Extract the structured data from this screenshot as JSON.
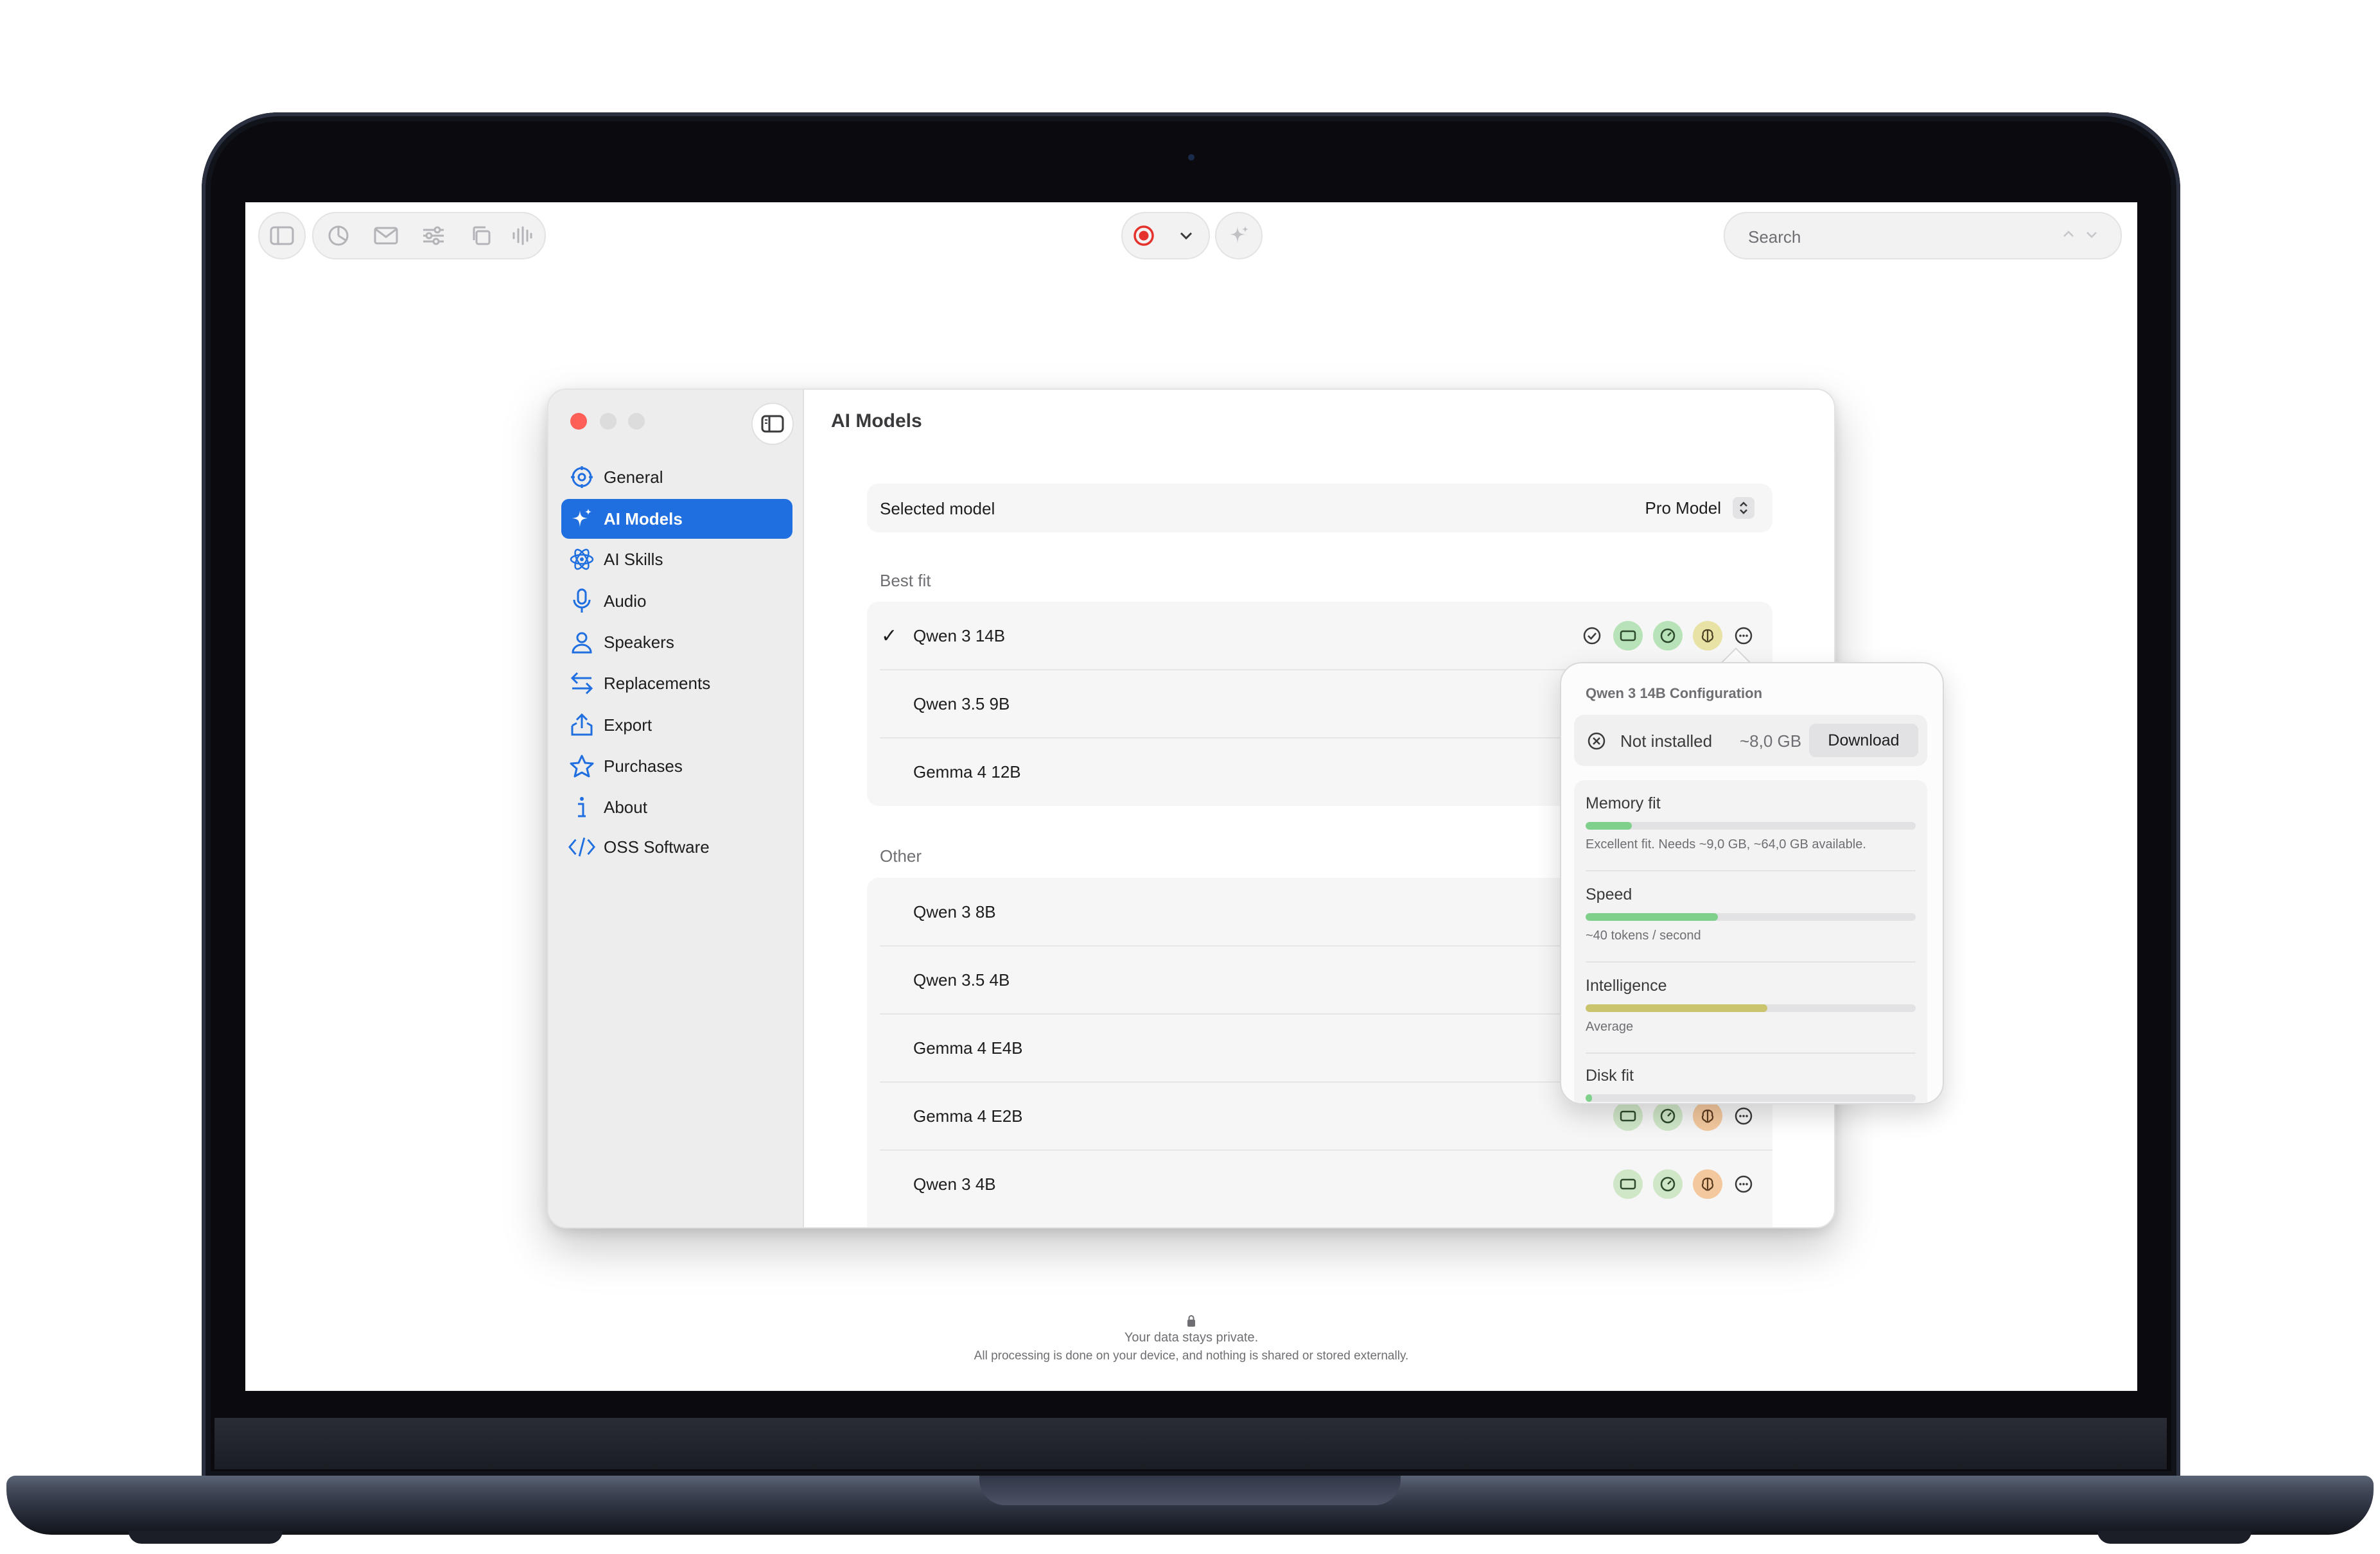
{
  "toolbar": {
    "search_placeholder": "Search"
  },
  "window": {
    "page_title": "AI Models",
    "traffic_light_colors": [
      "#fe5f57",
      "#d9d9d9",
      "#d9d9d9"
    ],
    "accent": "#1f6fe0"
  },
  "sidebar": {
    "items": [
      {
        "label": "General",
        "icon": "gear-icon"
      },
      {
        "label": "AI Models",
        "icon": "sparkles-icon",
        "active": true
      },
      {
        "label": "AI Skills",
        "icon": "atom-icon"
      },
      {
        "label": "Audio",
        "icon": "microphone-icon"
      },
      {
        "label": "Speakers",
        "icon": "person-icon"
      },
      {
        "label": "Replacements",
        "icon": "arrows-swap-icon"
      },
      {
        "label": "Export",
        "icon": "share-icon"
      },
      {
        "label": "Purchases",
        "icon": "star-icon"
      },
      {
        "label": "About",
        "icon": "info-icon"
      },
      {
        "label": "OSS Software",
        "icon": "code-icon"
      }
    ]
  },
  "selected_model": {
    "label": "Selected model",
    "value": "Pro Model"
  },
  "best_fit": {
    "title": "Best fit",
    "models": [
      {
        "name": "Qwen 3 14B",
        "selected": true
      },
      {
        "name": "Qwen 3.5 9B"
      },
      {
        "name": "Gemma 4 12B"
      }
    ]
  },
  "other": {
    "title": "Other",
    "models": [
      {
        "name": "Qwen 3 8B"
      },
      {
        "name": "Qwen 3.5 4B"
      },
      {
        "name": "Gemma 4 E4B"
      },
      {
        "name": "Gemma 4 E2B"
      },
      {
        "name": "Qwen 3 4B"
      }
    ]
  },
  "popover": {
    "title": "Qwen 3 14B Configuration",
    "status": "Not installed",
    "size": "~8,0 GB",
    "download_label": "Download",
    "metrics": [
      {
        "title": "Memory fit",
        "desc": "Excellent fit. Needs ~9,0 GB, ~64,0 GB available.",
        "level": 0.14,
        "color": "#7fd08b"
      },
      {
        "title": "Speed",
        "desc": "~40 tokens / second",
        "level": 0.4,
        "color": "#7fd08b"
      },
      {
        "title": "Intelligence",
        "desc": "Average",
        "level": 0.55,
        "color": "#c9c46d"
      },
      {
        "title": "Disk fit",
        "desc": "",
        "level": 0.02,
        "color": "#7fd08b"
      }
    ]
  },
  "privacy": {
    "line1": "Your data stays private.",
    "line2": "All processing is done on your device, and nothing is shared or stored externally."
  }
}
